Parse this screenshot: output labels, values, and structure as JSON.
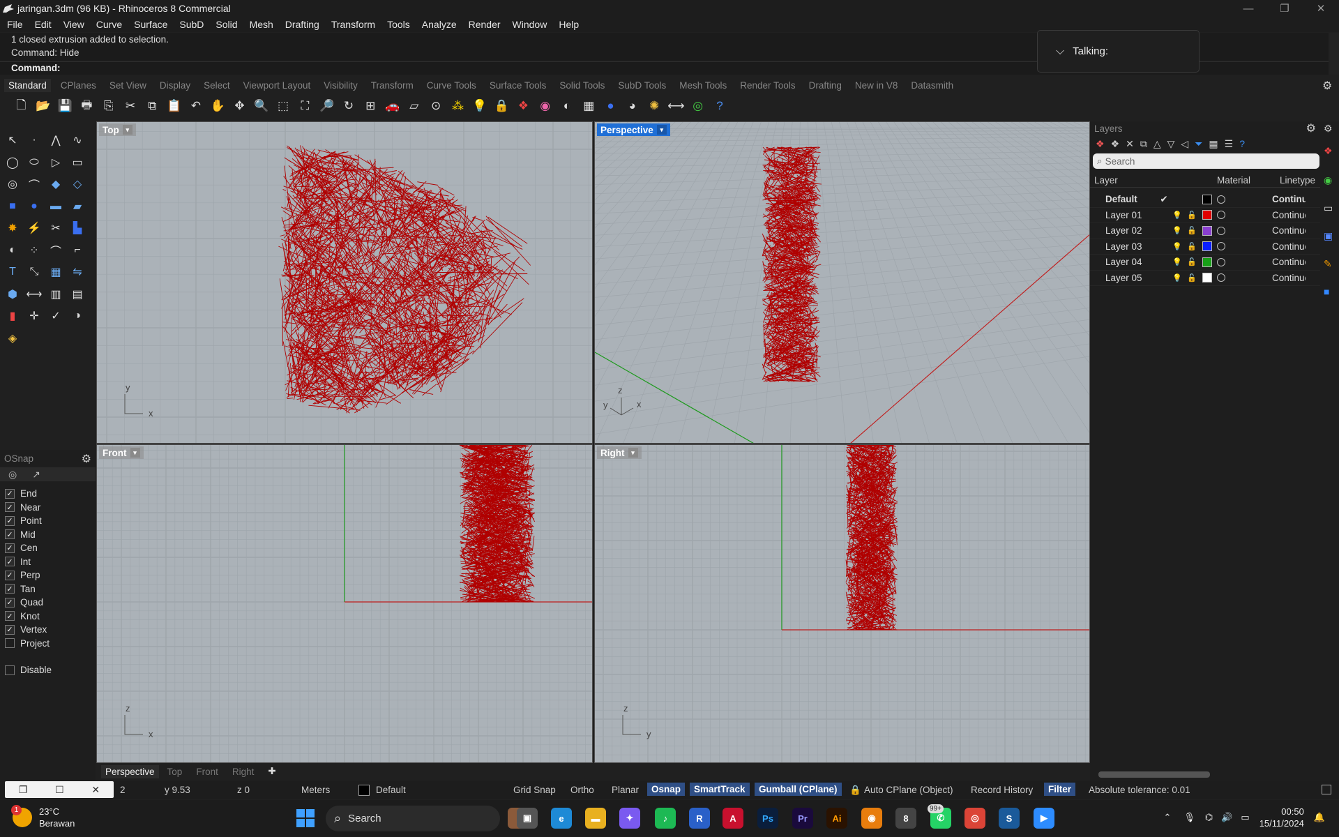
{
  "window": {
    "title": "jaringan.3dm (96 KB) - Rhinoceros 8 Commercial"
  },
  "menu": [
    "File",
    "Edit",
    "View",
    "Curve",
    "Surface",
    "SubD",
    "Solid",
    "Mesh",
    "Drafting",
    "Transform",
    "Tools",
    "Analyze",
    "Render",
    "Window",
    "Help"
  ],
  "command": {
    "history1": "1 closed extrusion added to selection.",
    "history2": "Command: Hide",
    "prompt": "Command:"
  },
  "talking": "Talking:",
  "tabs": [
    "Standard",
    "CPlanes",
    "Set View",
    "Display",
    "Select",
    "Viewport Layout",
    "Visibility",
    "Transform",
    "Curve Tools",
    "Surface Tools",
    "Solid Tools",
    "SubD Tools",
    "Mesh Tools",
    "Render Tools",
    "Drafting",
    "New in V8",
    "Datasmith"
  ],
  "viewports": {
    "top": "Top",
    "perspective": "Perspective",
    "front": "Front",
    "right": "Right"
  },
  "axes": {
    "x": "x",
    "y": "y",
    "z": "z"
  },
  "viewport_tabs": [
    "Perspective",
    "Top",
    "Front",
    "Right"
  ],
  "osnap": {
    "title": "OSnap",
    "items": [
      {
        "label": "End",
        "checked": true
      },
      {
        "label": "Near",
        "checked": true
      },
      {
        "label": "Point",
        "checked": true
      },
      {
        "label": "Mid",
        "checked": true
      },
      {
        "label": "Cen",
        "checked": true
      },
      {
        "label": "Int",
        "checked": true
      },
      {
        "label": "Perp",
        "checked": true
      },
      {
        "label": "Tan",
        "checked": true
      },
      {
        "label": "Quad",
        "checked": true
      },
      {
        "label": "Knot",
        "checked": true
      },
      {
        "label": "Vertex",
        "checked": true
      },
      {
        "label": "Project",
        "checked": false
      }
    ],
    "disable": "Disable"
  },
  "layers": {
    "title": "Layers",
    "search": "Search",
    "col_layer": "Layer",
    "col_material": "Material",
    "col_linetype": "Linetype",
    "rows": [
      {
        "name": "Default",
        "color": "#000000",
        "linetype": "Continuous",
        "current": true
      },
      {
        "name": "Layer 01",
        "color": "#e00000",
        "linetype": "Continuous"
      },
      {
        "name": "Layer 02",
        "color": "#8a3fd0",
        "linetype": "Continuous"
      },
      {
        "name": "Layer 03",
        "color": "#0a1fff",
        "linetype": "Continuous"
      },
      {
        "name": "Layer 04",
        "color": "#18a018",
        "linetype": "Continuous"
      },
      {
        "name": "Layer 05",
        "color": "#ffffff",
        "linetype": "Continuous"
      }
    ]
  },
  "status": {
    "x": "2",
    "y": "y 9.53",
    "z": "z 0",
    "units": "Meters",
    "layer": "Default",
    "grid_snap": "Grid Snap",
    "ortho": "Ortho",
    "planar": "Planar",
    "osnap": "Osnap",
    "smarttrack": "SmartTrack",
    "gumball": "Gumball (CPlane)",
    "autocplane": "Auto CPlane (Object)",
    "record_history": "Record History",
    "filter": "Filter",
    "tolerance": "Absolute tolerance: 0.01"
  },
  "taskbar": {
    "temp": "23°C",
    "weather": "Berawan",
    "weather_badge": "1",
    "search": "Search",
    "whatsapp_badge": "99+",
    "time": "00:50",
    "date": "15/11/2024"
  },
  "colors": {
    "object": "#b00000",
    "grid": "#9ea5ab",
    "viewport_bg": "#abb2b8",
    "accent": "#1f6fd6"
  }
}
